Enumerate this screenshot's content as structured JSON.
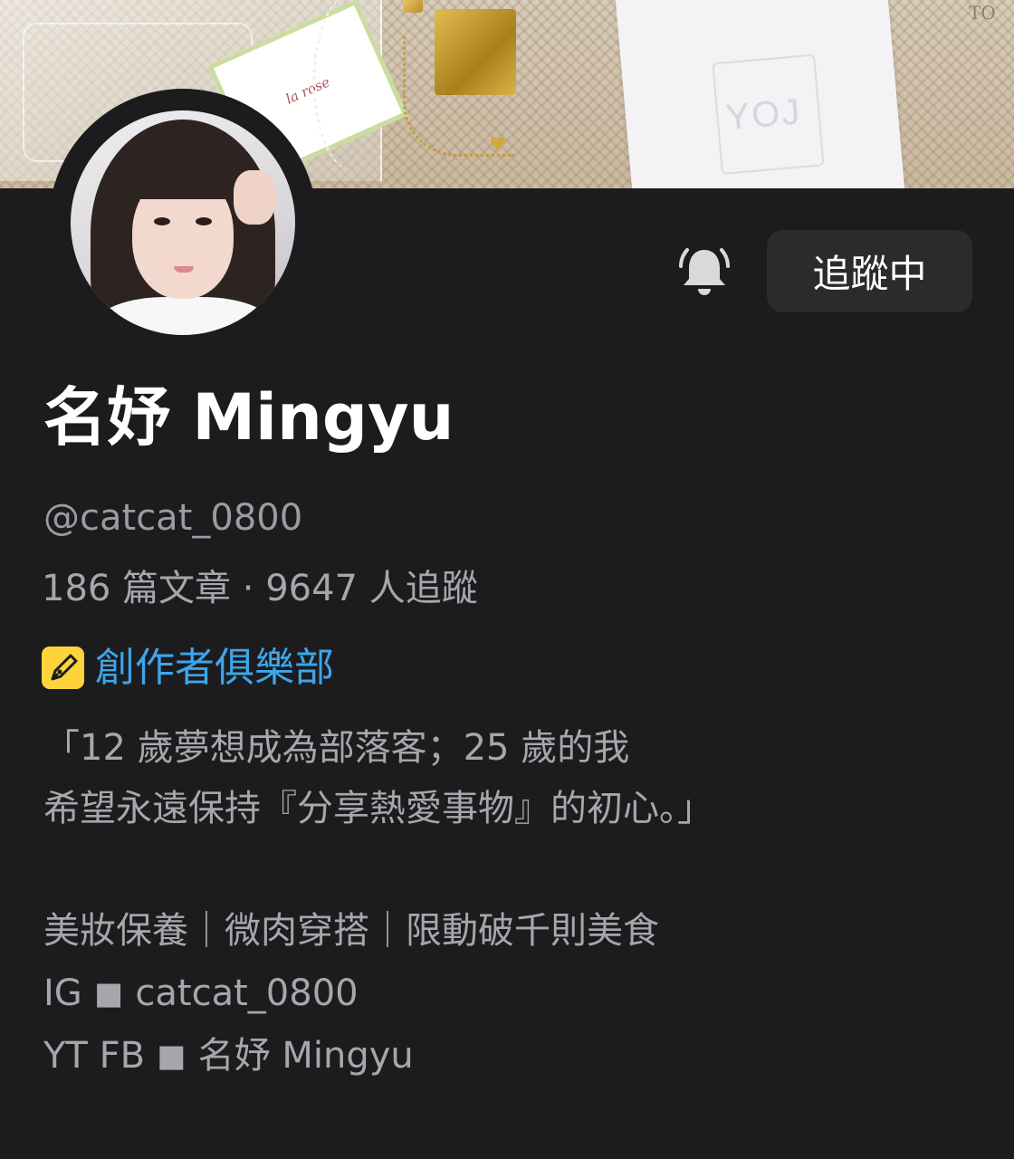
{
  "cover": {
    "tag_text": "la rose",
    "corner_text": "TO",
    "emboss_text": "YOJ"
  },
  "profile": {
    "name": "名妤 Mingyu",
    "handle": "@catcat_0800",
    "stats": "186 篇文章 · 9647 人追蹤",
    "club_label": "創作者俱樂部",
    "club_icon": "pen-nib-icon",
    "bio_lines": [
      "「12 歲夢想成為部落客；25 歲的我",
      "希望永遠保持『分享熱愛事物』的初心。」",
      "美妝保養｜微肉穿搭｜限動破千則美食",
      "IG ◼︎ catcat_0800",
      "YT FB ◼︎ 名妤 Mingyu"
    ]
  },
  "actions": {
    "notify_icon": "bell-icon",
    "follow_label": "追蹤中"
  },
  "colors": {
    "background": "#1c1c1f",
    "button_bg": "#2b2b2e",
    "club_accent": "#3ea6ea",
    "club_icon_bg": "#ffd43b",
    "muted_text": "#a7a7ab"
  }
}
